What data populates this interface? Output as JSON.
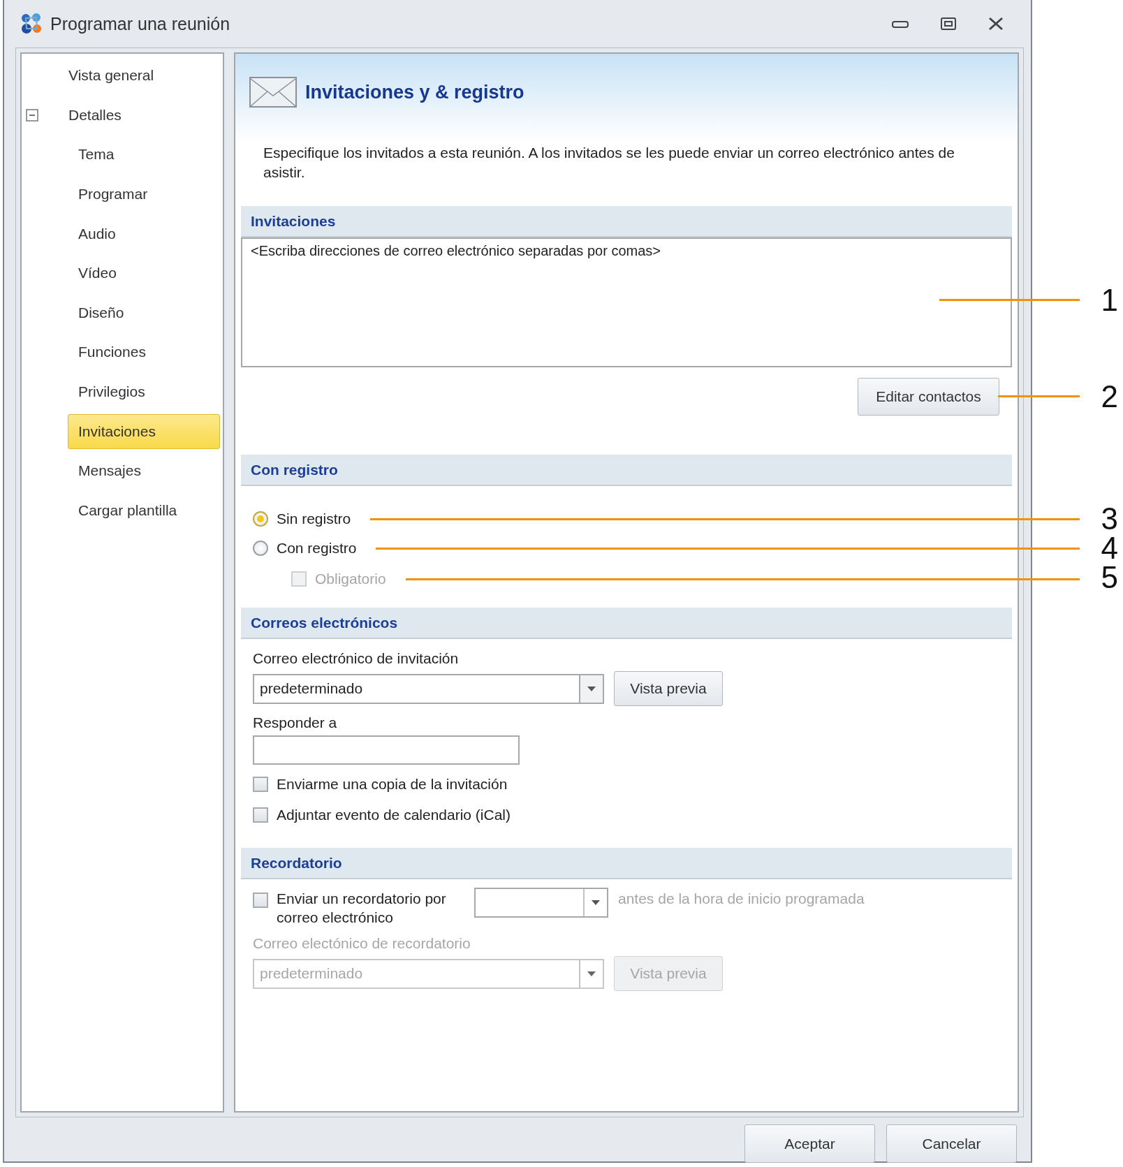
{
  "window": {
    "title": "Programar una reunión"
  },
  "sidebar": {
    "items": [
      {
        "label": "Vista general",
        "selected": false
      },
      {
        "label": "Detalles",
        "selected": false,
        "expanded": true,
        "children": [
          {
            "label": "Tema",
            "selected": false
          },
          {
            "label": "Programar",
            "selected": false
          },
          {
            "label": "Audio",
            "selected": false
          },
          {
            "label": "Vídeo",
            "selected": false
          },
          {
            "label": "Diseño",
            "selected": false
          },
          {
            "label": "Funciones",
            "selected": false
          },
          {
            "label": "Privilegios",
            "selected": false
          },
          {
            "label": "Invitaciones",
            "selected": true
          },
          {
            "label": "Mensajes",
            "selected": false
          },
          {
            "label": "Cargar plantilla",
            "selected": false
          }
        ]
      }
    ]
  },
  "page": {
    "title": "Invitaciones y & registro",
    "description": "Especifique los invitados a esta reunión. A los invitados se les puede enviar un correo electrónico antes de asistir."
  },
  "invitations": {
    "heading": "Invitaciones",
    "addresses": {
      "placeholder": "<Escriba direcciones de correo electrónico separadas por comas>",
      "callout": "1"
    },
    "button": {
      "label": "Editar contactos",
      "callout": "2"
    }
  },
  "registration": {
    "heading": "Con registro",
    "options": [
      {
        "label": "Sin registro",
        "selected": true,
        "callout": "3"
      },
      {
        "label": "Con registro",
        "selected": false,
        "callout": "4"
      }
    ],
    "required": {
      "label": "Obligatorio",
      "checked": false,
      "disabled": true,
      "callout": "5"
    }
  },
  "emails": {
    "heading": "Correos electrónicos",
    "invitation_label": "Correo electrónico de invitación",
    "invitation_select": {
      "value": "predeterminado"
    },
    "preview_button": "Vista previa",
    "reply_label": "Responder a",
    "checkboxes": [
      {
        "label": "Enviarme una copia de la invitación",
        "checked": false
      },
      {
        "label": "Adjuntar evento de calendario (iCal)",
        "checked": false
      }
    ]
  },
  "reminder": {
    "heading": "Recordatorio",
    "send": {
      "label": "Enviar un recordatorio por correo electrónico",
      "checked": false
    },
    "trailing": {
      "text": "antes de la hora de inicio programada",
      "disabled": true
    },
    "email_label": "Correo electónico de recordatorio",
    "email_select": {
      "value": "predeterminado"
    },
    "preview_button": "Vista previa",
    "disabled": true
  },
  "buttons": [
    "Aceptar",
    "Cancelar"
  ]
}
